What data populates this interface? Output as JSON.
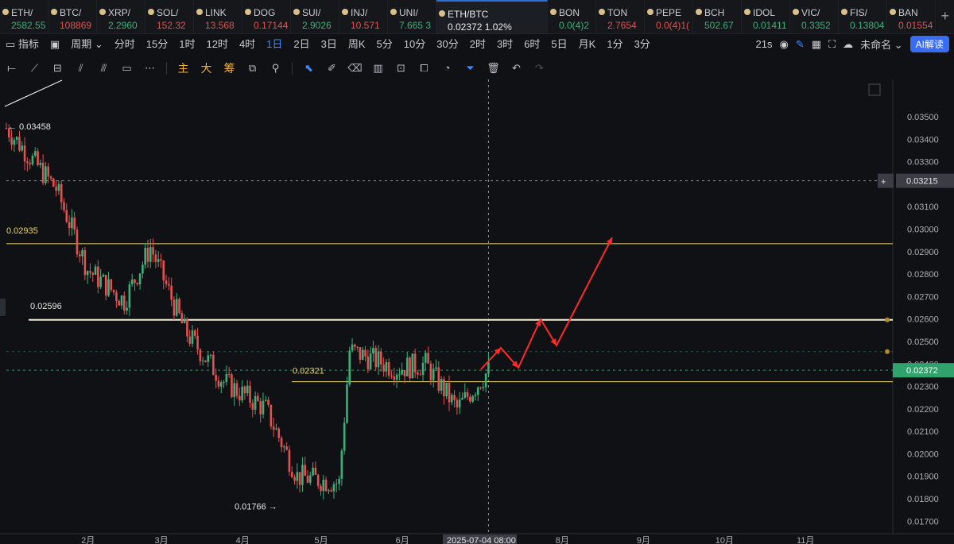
{
  "tickers": [
    {
      "symbol": "ETH/",
      "price": "2582.55",
      "dir": "up"
    },
    {
      "symbol": "BTC/",
      "price": "108869",
      "dir": "dn"
    },
    {
      "symbol": "XRP/",
      "price": "2.2960",
      "dir": "up"
    },
    {
      "symbol": "SOL/",
      "price": "152.32",
      "dir": "dn"
    },
    {
      "symbol": "LINK",
      "price": "13.568",
      "dir": "dn"
    },
    {
      "symbol": "DOG",
      "price": "0.17144",
      "dir": "dn"
    },
    {
      "symbol": "SUI/",
      "price": "2.9026",
      "dir": "up"
    },
    {
      "symbol": "INJ/",
      "price": "10.571",
      "dir": "dn"
    },
    {
      "symbol": "UNI/",
      "price": "7.665 3",
      "dir": "up"
    },
    {
      "symbol": "ETH/BTC",
      "price": "0.02372  1.02%",
      "dir": "up",
      "active": true
    },
    {
      "symbol": "BON",
      "price": "0.0(4)2",
      "dir": "up"
    },
    {
      "symbol": "TON",
      "price": "2.7654",
      "dir": "dn"
    },
    {
      "symbol": "PEPE",
      "price": "0.0(4)1(",
      "dir": "dn"
    },
    {
      "symbol": "BCH",
      "price": "502.67",
      "dir": "up"
    },
    {
      "symbol": "IDOL",
      "price": "0.01411",
      "dir": "up"
    },
    {
      "symbol": "VIC/",
      "price": "0.3352",
      "dir": "up"
    },
    {
      "symbol": "FIS/",
      "price": "0.13804",
      "dir": "up"
    },
    {
      "symbol": "BAN",
      "price": "0.01554",
      "dir": "dn"
    }
  ],
  "toolbar": {
    "indicators_label": "指标",
    "period_label": "周期",
    "intervals": [
      "分时",
      "15分",
      "1时",
      "12时",
      "4时",
      "1日",
      "2日",
      "3日",
      "周K",
      "5分",
      "10分",
      "30分",
      "2时",
      "3时",
      "6时",
      "5日",
      "月K",
      "1分",
      "3分"
    ],
    "selected_interval": "1日",
    "countdown": "21s",
    "layout_name": "未命名",
    "ai_label": "AI解读"
  },
  "tools": {
    "zhu": "主",
    "da": "大",
    "chou": "筹"
  },
  "colors": {
    "up": "#3db07a",
    "down": "#e15252",
    "accent": "#3f8cff",
    "level": "#e9d36b",
    "arrow": "#ff2a2a"
  },
  "annotations": {
    "high": "← 0.03458",
    "low": "0.01766 →",
    "level_1": "0.02935",
    "level_2": "0.02596",
    "level_3": "0.02321"
  },
  "crosshair": {
    "price": "0.03215",
    "time": "2025-07-04 08:00"
  },
  "last_price": "0.02372",
  "chart_data": {
    "type": "candlestick",
    "pair": "ETH/BTC",
    "interval": "1日",
    "y_ticks": [
      "0.03500",
      "0.03400",
      "0.03300",
      "0.03200",
      "0.03100",
      "0.03000",
      "0.02900",
      "0.02800",
      "0.02700",
      "0.02600",
      "0.02500",
      "0.02400",
      "0.02300",
      "0.02200",
      "0.02100",
      "0.02000",
      "0.01900",
      "0.01800",
      "0.01700"
    ],
    "x_ticks": [
      "2月",
      "3月",
      "4月",
      "5月",
      "6月",
      "8月",
      "9月",
      "10月",
      "11月"
    ],
    "ylim": [
      0.0168,
      0.0356
    ],
    "high": 0.03458,
    "low": 0.01766,
    "horizontal_levels": [
      0.02935,
      0.02596,
      0.02321
    ],
    "last_price": 0.02372,
    "key_points": [
      {
        "date": "2025-01-01",
        "close": 0.0345
      },
      {
        "date": "2025-01-20",
        "close": 0.0318
      },
      {
        "date": "2025-02-01",
        "close": 0.0282
      },
      {
        "date": "2025-02-15",
        "close": 0.0268
      },
      {
        "date": "2025-02-25",
        "close": 0.0292
      },
      {
        "date": "2025-03-10",
        "close": 0.0255
      },
      {
        "date": "2025-03-25",
        "close": 0.0232
      },
      {
        "date": "2025-04-10",
        "close": 0.022
      },
      {
        "date": "2025-04-22",
        "close": 0.019
      },
      {
        "date": "2025-05-08",
        "close": 0.0187
      },
      {
        "date": "2025-05-12",
        "close": 0.0246
      },
      {
        "date": "2025-05-30",
        "close": 0.0238
      },
      {
        "date": "2025-06-10",
        "close": 0.024
      },
      {
        "date": "2025-06-22",
        "close": 0.022
      },
      {
        "date": "2025-07-04",
        "close": 0.0237
      }
    ]
  }
}
